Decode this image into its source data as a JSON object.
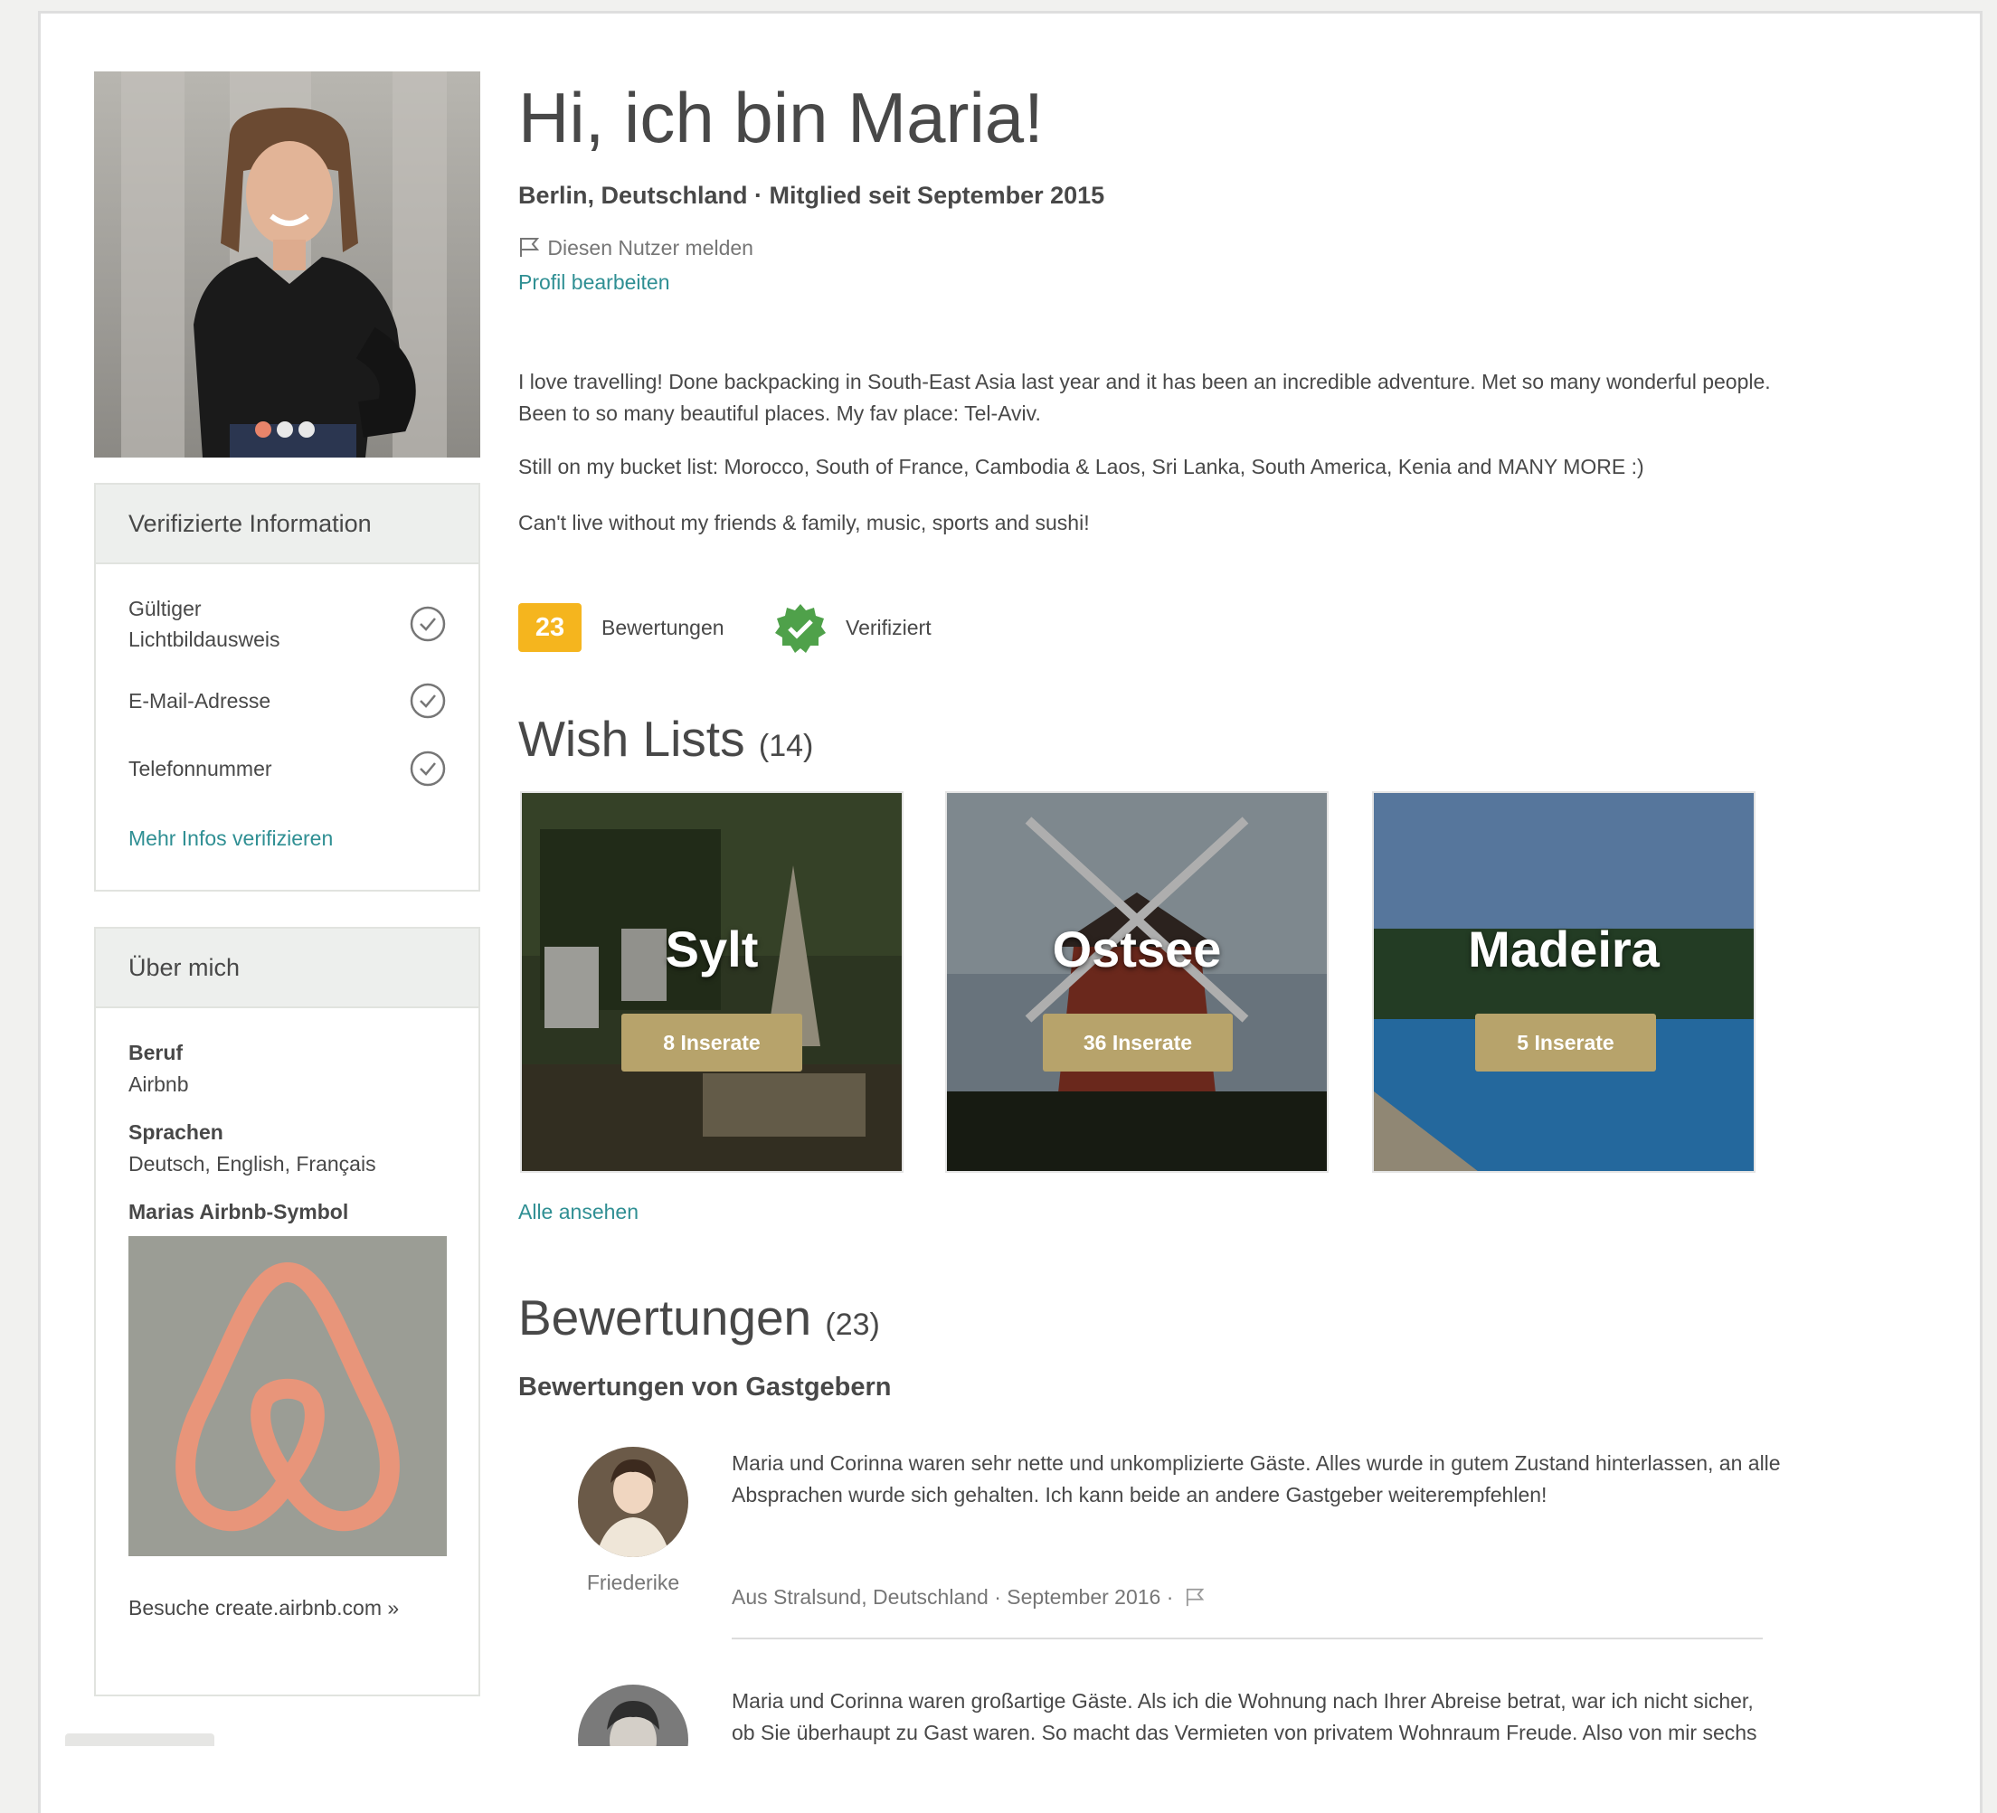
{
  "profile": {
    "title": "Hi, ich bin Maria!",
    "subtitle": "Berlin, Deutschland · Mitglied seit September 2015",
    "report_user": "Diesen Nutzer melden",
    "edit_profile": "Profil bearbeiten",
    "bio": [
      "I love travelling! Done backpacking in South-East Asia last year and it has been an incredible adventure. Met so many wonderful people. Been to so many beautiful places. My fav place: Tel-Aviv.",
      "Still on my bucket list: Morocco, South of France, Cambodia & Laos, Sri Lanka, South America, Kenia and MANY MORE :)",
      "Can't live without my friends & family, music, sports and sushi!"
    ],
    "photo_dots": 3
  },
  "verified_info": {
    "title": "Verifizierte Information",
    "items": [
      {
        "label": "Gültiger Lichtbildausweis",
        "icon": "check-circle-icon"
      },
      {
        "label": "E-Mail-Adresse",
        "icon": "check-circle-icon"
      },
      {
        "label": "Telefonnummer",
        "icon": "check-circle-icon"
      }
    ],
    "more_link": "Mehr Infos verifizieren"
  },
  "about": {
    "title": "Über mich",
    "job_label": "Beruf",
    "job_value": "Airbnb",
    "languages_label": "Sprachen",
    "languages_value": "Deutsch, English, Français",
    "symbol_label": "Marias Airbnb-Symbol",
    "create_link": "Besuche create.airbnb.com »"
  },
  "badges": {
    "review_count": "23",
    "review_label": "Bewertungen",
    "verified_label": "Verifiziert"
  },
  "wish_lists": {
    "title": "Wish Lists",
    "count": "(14)",
    "items": [
      {
        "name": "Sylt",
        "listings": "8 Inserate"
      },
      {
        "name": "Ostsee",
        "listings": "36 Inserate"
      },
      {
        "name": "Madeira",
        "listings": "5 Inserate"
      }
    ],
    "view_all": "Alle ansehen"
  },
  "reviews": {
    "title": "Bewertungen",
    "count": "(23)",
    "host_reviews_title": "Bewertungen von Gastgebern",
    "items": [
      {
        "reviewer": "Friederike",
        "text": "Maria und Corinna waren sehr nette und unkomplizierte Gäste. Alles wurde in gutem Zustand hinterlassen, an alle Absprachen wurde sich gehalten. Ich kann beide an andere Gastgeber weiterempfehlen!",
        "meta": "Aus Stralsund, Deutschland · September 2016 ·"
      },
      {
        "text": "Maria und Corinna waren großartige Gäste. Als ich die Wohnung nach Ihrer Abreise betrat, war ich nicht sicher, ob Sie überhaupt zu Gast waren. So macht das Vermieten von privatem Wohnraum Freude. Also von mir sechs von fünf Sternen! Danke und jederzeit wieder!"
      }
    ]
  },
  "colors": {
    "link": "#2f8f93",
    "badge": "#f5b51e",
    "verified": "#4fa14a",
    "pill": "#b7a36b",
    "logo": "#e8957a"
  }
}
